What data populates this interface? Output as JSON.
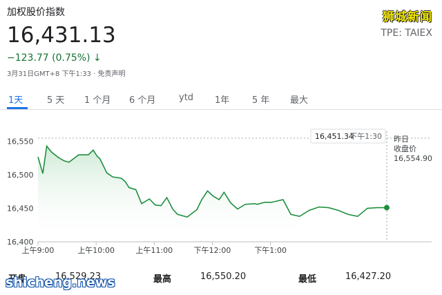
{
  "header": {
    "title": "加权股价指数",
    "brand": "狮城新闻",
    "ticker": "TPE: TAIEX",
    "price": "16,431.13",
    "change": "−123.77 (0.75%)",
    "change_arrow": "↓",
    "timestamp": "3月31日GMT+8 下午1:33 · 免责声明"
  },
  "tabs": [
    {
      "label": "1天",
      "active": true
    },
    {
      "label": "5 天"
    },
    {
      "label": "1 个月"
    },
    {
      "label": "6 个月"
    },
    {
      "label": "ytd"
    },
    {
      "label": "1年"
    },
    {
      "label": "5 年"
    },
    {
      "label": "最大"
    }
  ],
  "colors": {
    "line": "#1e8e3e",
    "fill": "#e6f4ea",
    "accent": "#1a73e8",
    "down": "#137333"
  },
  "chart_data": {
    "type": "area",
    "x_ticks": [
      "上午9:00",
      "上午10:00",
      "上午11:00",
      "下午12:00",
      "下午1:00"
    ],
    "x_tick_values": [
      0,
      60,
      120,
      180,
      240
    ],
    "y_ticks": [
      "16,550",
      "16,500",
      "16,450",
      "16,400"
    ],
    "y_tick_values": [
      16550,
      16500,
      16450,
      16400
    ],
    "xlim": [
      0,
      270
    ],
    "ylim": [
      16400,
      16560
    ],
    "grid": false,
    "series": [
      {
        "x": [
          0,
          5,
          9,
          14,
          21,
          27,
          32,
          42,
          52,
          57,
          61,
          64,
          71,
          77,
          86,
          90,
          94,
          101,
          107,
          115,
          121,
          127,
          133,
          139,
          144,
          154,
          164,
          169,
          175,
          181,
          187,
          192,
          199,
          206,
          214,
          224,
          226,
          234,
          241,
          247,
          253,
          261,
          270
        ],
        "y": [
          16527,
          16502,
          16543,
          16534,
          16526,
          16521,
          16519,
          16530,
          16530,
          16537,
          16528,
          16524,
          16503,
          16497,
          16495,
          16490,
          16481,
          16478,
          16457,
          16464,
          16455,
          16454,
          16466,
          16449,
          16441,
          16437,
          16448,
          16463,
          16476,
          16468,
          16463,
          16474,
          16458,
          16449,
          16456,
          16457,
          16456,
          16459,
          16459,
          16461,
          16463,
          16441,
          16438
        ]
      },
      {
        "x": [
          270,
          280,
          290,
          300,
          310,
          320,
          330,
          340,
          350,
          360
        ],
        "y": [
          16438,
          16447,
          16452,
          16451,
          16447,
          16441,
          16438,
          16450,
          16451,
          16451
        ]
      }
    ],
    "reference_value": 16554.9,
    "reference_label": "昨日\n收盘价",
    "reference_value_label": "16,554.90",
    "tooltip": {
      "value": "16,451.34",
      "time": "下午1:30"
    }
  },
  "stats": [
    {
      "label": "开盘",
      "value": "16,529.23"
    },
    {
      "label": "最高",
      "value": "16,550.20"
    },
    {
      "label": "最低",
      "value": "16,427.20"
    }
  ],
  "watermark": "shicheng.news"
}
